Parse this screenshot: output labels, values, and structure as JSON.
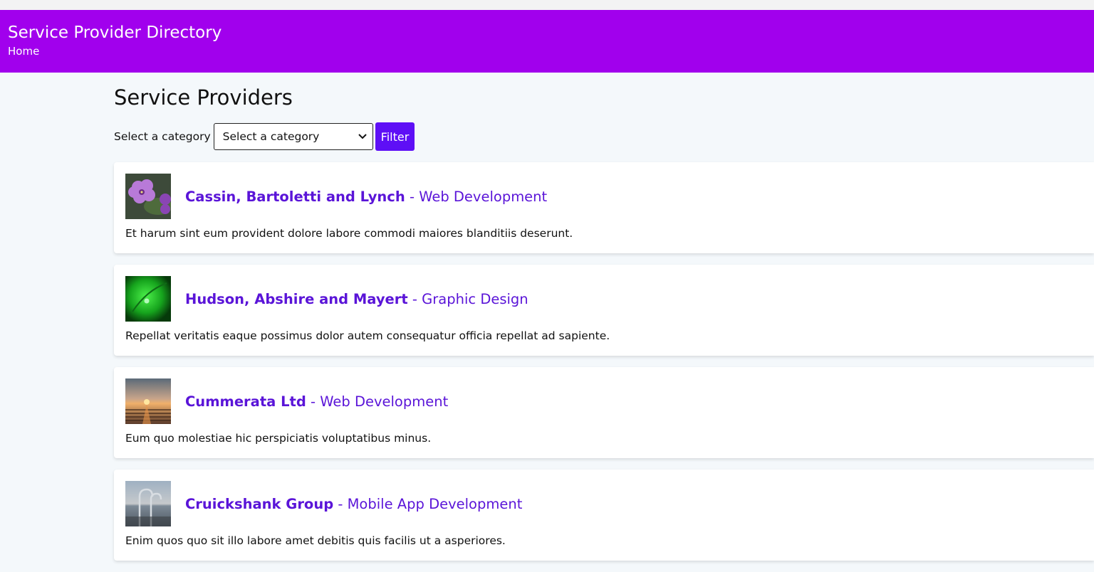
{
  "header": {
    "title": "Service Provider Directory",
    "nav_home": "Home"
  },
  "main": {
    "title": "Service Providers",
    "filter": {
      "label": "Select a category",
      "select_value": "Select a category",
      "button": "Filter"
    },
    "providers": [
      {
        "name": "Cassin, Bartoletti and Lynch",
        "separator": " - ",
        "category": "Web Development",
        "description": "Et harum sint eum provident dolore labore commodi maiores blanditiis deserunt.",
        "image": "purple-flower-photo"
      },
      {
        "name": "Hudson, Abshire and Mayert",
        "separator": " - ",
        "category": "Graphic Design",
        "description": "Repellat veritatis eaque possimus dolor autem consequatur officia repellat ad sapiente.",
        "image": "green-leaf-photo"
      },
      {
        "name": "Cummerata Ltd",
        "separator": " - ",
        "category": "Web Development",
        "description": "Eum quo molestiae hic perspiciatis voluptatibus minus.",
        "image": "sunset-boardwalk-photo"
      },
      {
        "name": "Cruickshank Group",
        "separator": " - ",
        "category": "Mobile App Development",
        "description": "Enim quos quo sit illo labore amet debitis quis facilis ut a asperiores.",
        "image": "pool-ladder-sea-photo"
      }
    ]
  },
  "colors": {
    "header_bg": "#a100ed",
    "accent": "#5e0ff6",
    "link": "#5a14d8"
  }
}
